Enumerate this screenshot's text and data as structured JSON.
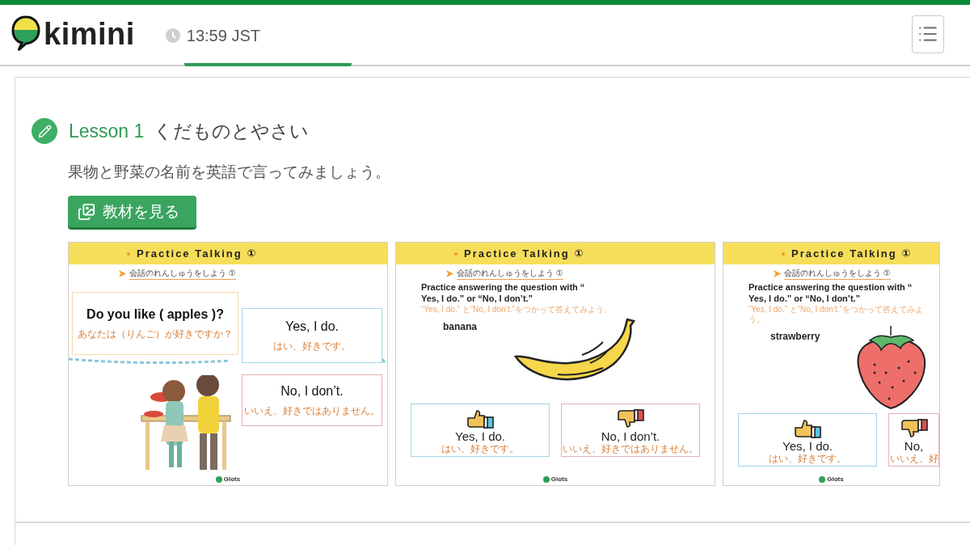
{
  "header": {
    "logo": "kimini",
    "time": "13:59 JST"
  },
  "tabs": [
    {
      "selected": true
    }
  ],
  "lesson": {
    "number": "Lesson 1",
    "title": "くだものとやさい",
    "description": "果物と野菜の名前を英語で言ってみましょう。",
    "button": "教材を見る",
    "slides": [
      {
        "kind": "dialogue",
        "heading": "Practice Talking ①",
        "subheading": "会話のれんしゅうをしよう ①",
        "question": "Do you like ( apples )?",
        "question_ja": "あなたは（りんご）が好きですか？",
        "answers": [
          {
            "kind": "yes",
            "text": "Yes, I do.",
            "ja": "はい、好きです。"
          },
          {
            "kind": "no",
            "text": "No, I don’t.",
            "ja": "いいえ、好きではありません。"
          }
        ],
        "brand": "Glots"
      },
      {
        "kind": "vocab",
        "heading": "Practice Talking ①",
        "subheading": "会話のれんしゅうをしよう ①",
        "instruction": "Practice answering the question with “ Yes, I do.” or “No, I don’t.”",
        "hint": "“Yes, I do.” と“No, I don’t.”をつかって答えてみよう。",
        "word": "banana",
        "answers": [
          {
            "kind": "yes",
            "text": "Yes, I do.",
            "ja": "はい、好きです。"
          },
          {
            "kind": "no",
            "text": "No, I don’t.",
            "ja": "いいえ、好きではありません。"
          }
        ],
        "brand": "Glots"
      },
      {
        "kind": "vocab",
        "heading": "Practice Talking ①",
        "subheading": "会話のれんしゅうをしよう ①",
        "instruction": "Practice answering the question with “ Yes, I do.” or “No, I don’t.”",
        "hint": "“Yes, I do.” と“No, I don’t.”をつかって答えてみよう。",
        "word": "strawberry",
        "answers": [
          {
            "kind": "yes",
            "text": "Yes, I do.",
            "ja": "はい、好きです。"
          },
          {
            "kind": "no",
            "text": "No,",
            "ja": "いいえ、好"
          }
        ],
        "brand": "Glots"
      }
    ]
  }
}
